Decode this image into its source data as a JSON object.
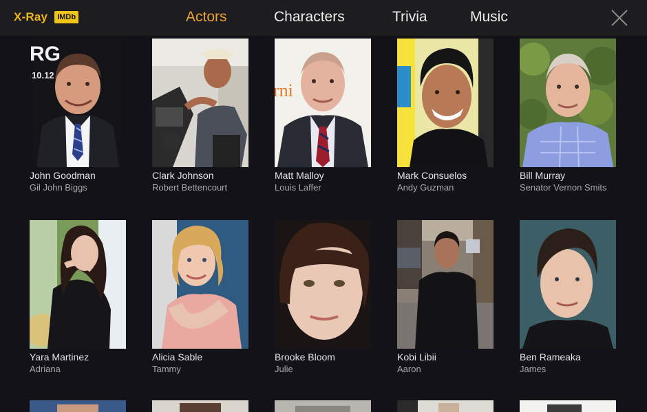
{
  "header": {
    "brand": "X-Ray",
    "imdb_badge": "IMDb",
    "tabs": [
      {
        "label": "Actors",
        "active": true
      },
      {
        "label": "Characters",
        "active": false
      },
      {
        "label": "Trivia",
        "active": false
      },
      {
        "label": "Music",
        "active": false
      }
    ],
    "close_icon": "close-icon"
  },
  "colors": {
    "accent": "#e9a233",
    "brand": "#f0b81e",
    "background": "#131219",
    "topbar": "#1d1c1f"
  },
  "actors": [
    {
      "name": "John Goodman",
      "character": "Gil John Biggs",
      "photo_text": "RG",
      "photo_subtext": "10.12"
    },
    {
      "name": "Clark Johnson",
      "character": "Robert Bettencourt"
    },
    {
      "name": "Matt Malloy",
      "character": "Louis Laffer",
      "photo_text": "rni"
    },
    {
      "name": "Mark Consuelos",
      "character": "Andy Guzman"
    },
    {
      "name": "Bill Murray",
      "character": "Senator Vernon Smits"
    },
    {
      "name": "Yara Martinez",
      "character": "Adriana"
    },
    {
      "name": "Alicia Sable",
      "character": "Tammy"
    },
    {
      "name": "Brooke Bloom",
      "character": "Julie"
    },
    {
      "name": "Kobi Libii",
      "character": "Aaron"
    },
    {
      "name": "Ben Rameaka",
      "character": "James"
    }
  ]
}
